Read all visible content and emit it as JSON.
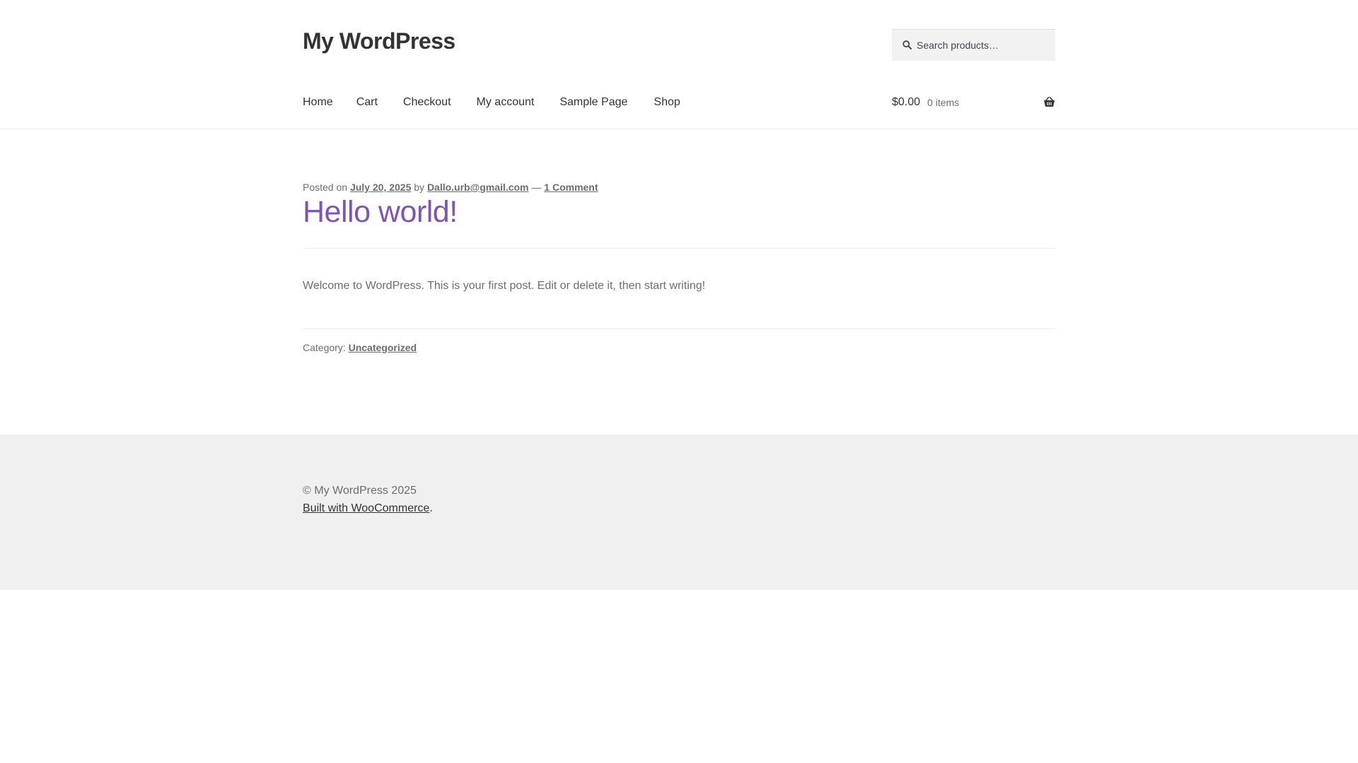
{
  "site": {
    "title": "My WordPress"
  },
  "search": {
    "placeholder": "Search products…",
    "value": "",
    "icon": "search-icon"
  },
  "nav": {
    "items": [
      {
        "label": "Home"
      },
      {
        "label": "Cart"
      },
      {
        "label": "Checkout"
      },
      {
        "label": "My account"
      },
      {
        "label": "Sample Page"
      },
      {
        "label": "Shop"
      }
    ]
  },
  "cart": {
    "amount": "$0.00",
    "count": "0 items",
    "icon": "basket-icon"
  },
  "post": {
    "meta_prefix": "Posted on",
    "date": "July 20, 2025",
    "by": "by",
    "author": "Dallo.urb@gmail.com",
    "dash": "—",
    "comments": "1 Comment",
    "title": "Hello world!",
    "body": "Welcome to WordPress. This is your first post. Edit or delete it, then start writing!",
    "category_label": "Category:",
    "category": "Uncategorized"
  },
  "footer": {
    "copyright": "© My WordPress 2025",
    "built_link": "Built with WooCommerce",
    "built_suffix": "."
  },
  "colors": {
    "accent": "#7f54b3",
    "text": "#6d6d6d",
    "heading": "#333333",
    "footer_bg": "#f0f0f0"
  }
}
